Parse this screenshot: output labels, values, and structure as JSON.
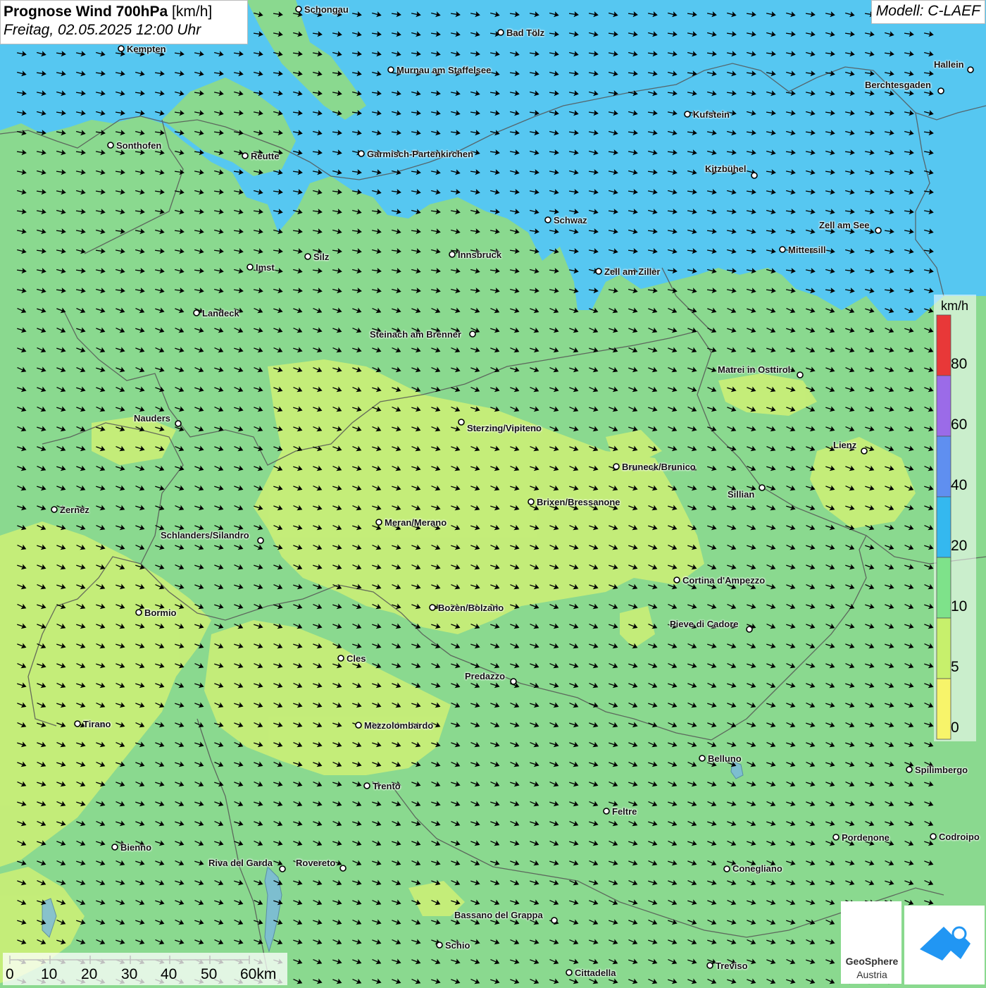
{
  "title": {
    "main": "Prognose Wind 700hPa",
    "unit": "[km/h]",
    "datetime": "Freitag, 02.05.2025 12:00 Uhr"
  },
  "model": "Modell: C-LAEF",
  "legend": {
    "unit": "km/h",
    "ticks": [
      "80",
      "60",
      "40",
      "20",
      "10",
      "5",
      "0"
    ],
    "colors": [
      "#e83838",
      "#9b6be8",
      "#5f8ff0",
      "#34b8ef",
      "#7ee28a",
      "#c7f06c",
      "#f7f46a"
    ]
  },
  "scale": {
    "labels": [
      "0",
      "10",
      "20",
      "30",
      "40",
      "50",
      "60km"
    ]
  },
  "colors": {
    "low_wind": "#c7ee78",
    "mid_wind": "#8ad98f",
    "high_wind": "#56c7f1",
    "arrow": "#000000",
    "border": "#555555"
  },
  "cities": [
    {
      "name": "Schongau"
    },
    {
      "name": "Bad Tölz"
    },
    {
      "name": "Kempten"
    },
    {
      "name": "Murnau am Staffelsee"
    },
    {
      "name": "Hallein"
    },
    {
      "name": "Berchtesgaden"
    },
    {
      "name": "Kufstein"
    },
    {
      "name": "Sonthofen"
    },
    {
      "name": "Reutte"
    },
    {
      "name": "Garmisch-Partenkirchen"
    },
    {
      "name": "Kitzbühel"
    },
    {
      "name": "Schwaz"
    },
    {
      "name": "Zell am See"
    },
    {
      "name": "Mittersill"
    },
    {
      "name": "Innsbruck"
    },
    {
      "name": "Silz"
    },
    {
      "name": "Imst"
    },
    {
      "name": "Zell am Ziller"
    },
    {
      "name": "Landeck"
    },
    {
      "name": "Steinach am Brenner"
    },
    {
      "name": "Matrei in Osttirol"
    },
    {
      "name": "Nauders"
    },
    {
      "name": "Sterzing/Vipiteno"
    },
    {
      "name": "Lienz"
    },
    {
      "name": "Bruneck/Brunico"
    },
    {
      "name": "Sillian"
    },
    {
      "name": "Brixen/Bressanone"
    },
    {
      "name": "Zernez"
    },
    {
      "name": "Meran/Merano"
    },
    {
      "name": "Schlanders/Silandro"
    },
    {
      "name": "Cortina d'Ampezzo"
    },
    {
      "name": "Bozen/Bolzano"
    },
    {
      "name": "Bormio"
    },
    {
      "name": "Pieve di Cadore"
    },
    {
      "name": "Cles"
    },
    {
      "name": "Predazzo"
    },
    {
      "name": "Tirano"
    },
    {
      "name": "Mezzolombardo"
    },
    {
      "name": "Belluno"
    },
    {
      "name": "Spilimbergo"
    },
    {
      "name": "Trento"
    },
    {
      "name": "Feltre"
    },
    {
      "name": "Pordenone"
    },
    {
      "name": "Codroipo"
    },
    {
      "name": "Bienno"
    },
    {
      "name": "Riva del Garda"
    },
    {
      "name": "Rovereto"
    },
    {
      "name": "Conegliano"
    },
    {
      "name": "Bassano del Grappa"
    },
    {
      "name": "Schio"
    },
    {
      "name": "Treviso"
    },
    {
      "name": "Cittadella"
    }
  ],
  "logos": {
    "geosphere_line1": "GeoSphere",
    "geosphere_line2": "Austria"
  }
}
